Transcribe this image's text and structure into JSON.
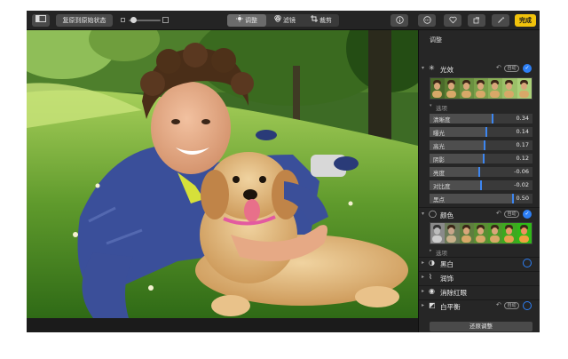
{
  "toolbar": {
    "sidebar_icon": "sidebar-icon",
    "revert_label": "复原到原始状态",
    "tabs": [
      {
        "label": "调整",
        "icon": "adjust-dial-icon",
        "selected": true
      },
      {
        "label": "滤镜",
        "icon": "filters-icon",
        "selected": false
      },
      {
        "label": "裁剪",
        "icon": "crop-icon",
        "selected": false
      }
    ],
    "info_icon": "info-icon",
    "more_icon": "ellipsis-icon",
    "favorite_icon": "heart-icon",
    "rotate_icon": "rotate-icon",
    "enhance_icon": "magic-wand-icon",
    "done_label": "完成",
    "accent_color": "#f2c30b"
  },
  "panel": {
    "title": "调整",
    "auto_label": "自动",
    "sections": {
      "light": {
        "label": "光效",
        "icon": "sun-icon",
        "enabled": true
      },
      "color": {
        "label": "颜色",
        "icon": "color-circle-icon",
        "enabled": true
      },
      "bw": {
        "label": "黑白",
        "icon": "half-circle-icon",
        "enabled": false
      },
      "retouch": {
        "label": "润饰",
        "icon": "bandage-icon"
      },
      "redeye": {
        "label": "消除红眼",
        "icon": "eye-icon"
      },
      "wb": {
        "label": "白平衡",
        "icon": "white-balance-icon",
        "enabled": false
      }
    },
    "options_label": "选项",
    "light_sliders": [
      {
        "name": "清晰度",
        "value": "0.34",
        "level": 0.6
      },
      {
        "name": "曝光",
        "value": "0.14",
        "level": 0.54
      },
      {
        "name": "高光",
        "value": "0.17",
        "level": 0.53
      },
      {
        "name": "阴影",
        "value": "0.12",
        "level": 0.52
      },
      {
        "name": "亮度",
        "value": "-0.06",
        "level": 0.47
      },
      {
        "name": "对比度",
        "value": "-0.02",
        "level": 0.49
      },
      {
        "name": "黑点",
        "value": "0.50",
        "level": 0.8
      }
    ],
    "reset_label": "还原调整",
    "accent_color": "#2d7ff5"
  }
}
